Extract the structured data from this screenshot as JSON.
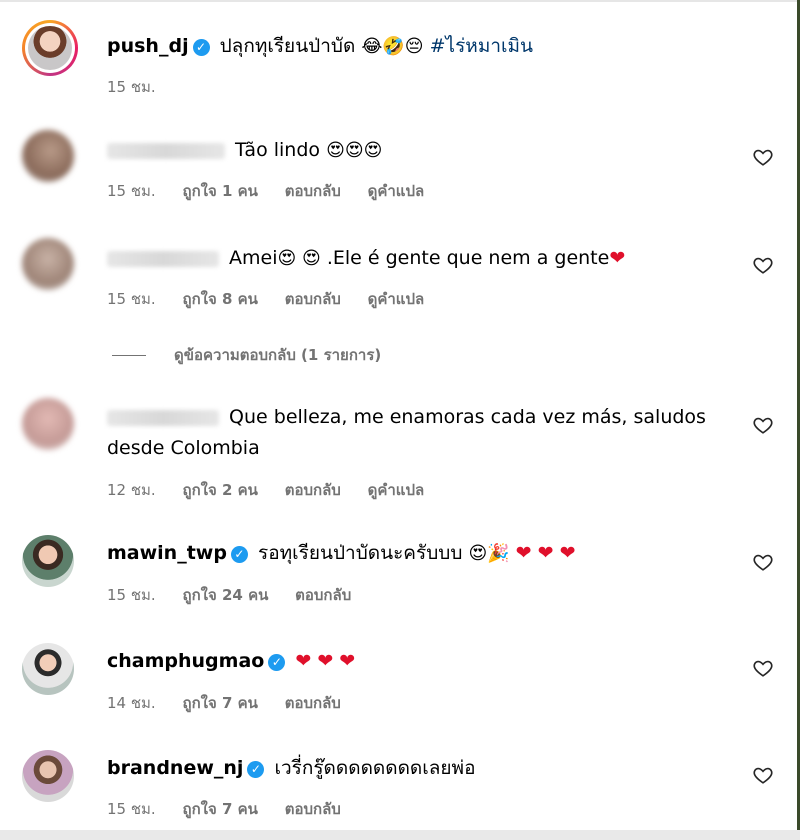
{
  "post": {
    "username": "push_dj",
    "caption": "ปลุกทุเรียนป่าบัด",
    "emojis": "😂🤣😔",
    "hashtag": "#ไร่หมาเมิน",
    "time": "15 ชม."
  },
  "comments": [
    {
      "text": "Tão lindo",
      "emojis": "😍😍😍",
      "time": "15 ชม.",
      "likes": "ถูกใจ 1 คน",
      "reply": "ตอบกลับ",
      "translate": "ดูคำแปล"
    },
    {
      "text_a": "Amei",
      "emojis_a": "😍 😍",
      "text_b": " .Ele é gente que nem a gente",
      "heart": "❤",
      "time": "15 ชม.",
      "likes": "ถูกใจ 8 คน",
      "reply": "ตอบกลับ",
      "translate": "ดูคำแปล",
      "view_replies": "ดูข้อความตอบกลับ (1 รายการ)"
    },
    {
      "text_line1": "Que belleza, me enamoras cada vez más, saludos",
      "text_line2": "desde Colombia",
      "time": "12 ชม.",
      "likes": "ถูกใจ 2 คน",
      "reply": "ตอบกลับ",
      "translate": "ดูคำแปล"
    },
    {
      "username": "mawin_twp",
      "text": "รอทุเรียนป่าบัดนะครับบบ",
      "emojis": "😍🎉",
      "hearts": "❤ ❤ ❤",
      "time": "15 ชม.",
      "likes": "ถูกใจ 24 คน",
      "reply": "ตอบกลับ"
    },
    {
      "username": "champhugmao",
      "hearts": "❤ ❤ ❤",
      "time": "14 ชม.",
      "likes": "ถูกใจ 7 คน",
      "reply": "ตอบกลับ"
    },
    {
      "username": "brandnew_nj",
      "text": "เวรี่กรู๊ดดดดดดดดเลยพ่อ",
      "time": "15 ชม.",
      "likes": "ถูกใจ 7 คน",
      "reply": "ตอบกลับ"
    }
  ],
  "icons": {
    "like": "heart-outline-icon",
    "verified": "verified-badge-icon"
  },
  "colors": {
    "meta": "#737373",
    "hashtag": "#00376b",
    "verified": "#1d9bf0",
    "heart": "#e0102b"
  }
}
